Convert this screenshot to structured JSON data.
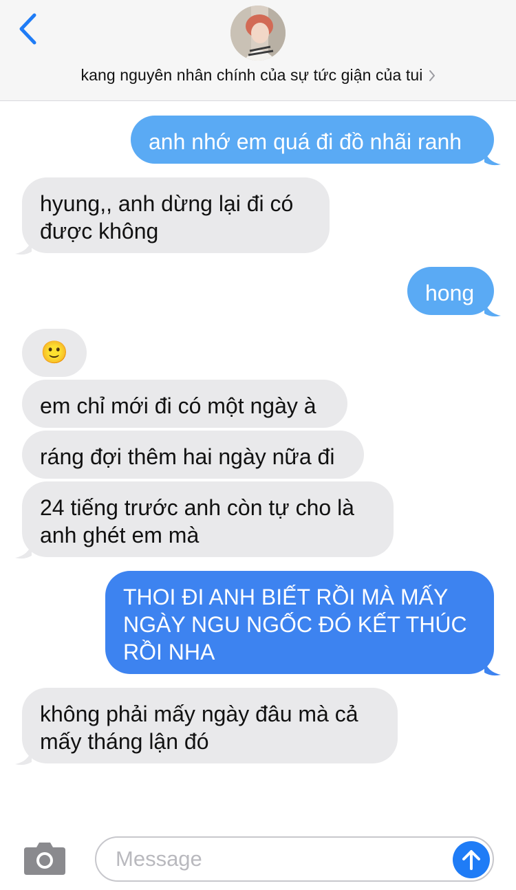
{
  "header": {
    "contact_name": "kang nguyên nhân chính của sự tức giận của tui",
    "back_icon": "chevron-left-icon",
    "details_icon": "chevron-right-icon"
  },
  "messages": [
    {
      "from": "me",
      "text": "anh nhớ em quá đi đồ nhãi ranh"
    },
    {
      "from": "them",
      "text": "hyung,, anh dừng lại đi có được không"
    },
    {
      "from": "me",
      "text": "hong"
    },
    {
      "from": "them",
      "text": "🙂"
    },
    {
      "from": "them",
      "text": "em chỉ mới đi có một ngày à"
    },
    {
      "from": "them",
      "text": "ráng đợi thêm hai ngày nữa đi"
    },
    {
      "from": "them",
      "text": "24 tiếng trước anh còn tự cho là anh ghét em mà"
    },
    {
      "from": "me",
      "text": "THOI ĐI ANH BIẾT RỒI MÀ MẤY NGÀY NGU NGỐC ĐÓ KẾT THÚC RỒI NHA"
    },
    {
      "from": "them",
      "text": "không phải mấy ngày đâu mà cả mấy tháng lận đó"
    }
  ],
  "composer": {
    "placeholder": "Message",
    "camera_icon": "camera-icon",
    "send_icon": "arrow-up-icon"
  },
  "colors": {
    "sent_bubble": "#5aaaf4",
    "sent_bubble_latest": "#3d83f0",
    "received_bubble": "#e9e9eb",
    "accent": "#1f7cf6"
  }
}
